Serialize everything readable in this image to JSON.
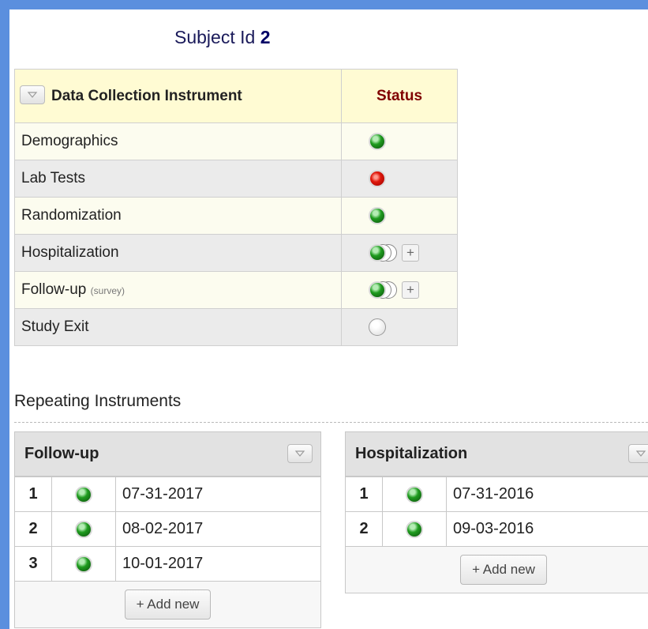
{
  "subject": {
    "label": "Subject Id",
    "value": "2"
  },
  "main_table": {
    "header_instrument": "Data Collection Instrument",
    "header_status": "Status",
    "rows": [
      {
        "name": "Demographics",
        "sublabel": "",
        "status": "green",
        "repeating": false
      },
      {
        "name": "Lab Tests",
        "sublabel": "",
        "status": "red",
        "repeating": false
      },
      {
        "name": "Randomization",
        "sublabel": "",
        "status": "green",
        "repeating": false
      },
      {
        "name": "Hospitalization",
        "sublabel": "",
        "status": "green",
        "repeating": true
      },
      {
        "name": "Follow-up",
        "sublabel": "(survey)",
        "status": "green",
        "repeating": true
      },
      {
        "name": "Study Exit",
        "sublabel": "",
        "status": "gray",
        "repeating": false
      }
    ],
    "plus_label": "+"
  },
  "repeating": {
    "title": "Repeating Instruments",
    "followup": {
      "title": "Follow-up",
      "rows": [
        {
          "num": "1",
          "status": "green",
          "date": "07-31-2017"
        },
        {
          "num": "2",
          "status": "green",
          "date": "08-02-2017"
        },
        {
          "num": "3",
          "status": "green",
          "date": "10-01-2017"
        }
      ],
      "add_label": "+ Add new"
    },
    "hospitalization": {
      "title": "Hospitalization",
      "rows": [
        {
          "num": "1",
          "status": "green",
          "date": "07-31-2016"
        },
        {
          "num": "2",
          "status": "green",
          "date": "09-03-2016"
        }
      ],
      "add_label": "+ Add new"
    }
  },
  "colors": {
    "background_blue": "#5b8fde",
    "header_yellow": "#fffbd3",
    "status_header": "#800000",
    "complete_green": "#1f9c1f",
    "incomplete_red": "#e0180c"
  },
  "icons": {
    "collapse": "triangle-down-icon",
    "complete": "green-dot-icon",
    "incomplete": "red-dot-icon",
    "empty": "gray-dot-icon",
    "multiple": "stacked-dots-icon"
  }
}
